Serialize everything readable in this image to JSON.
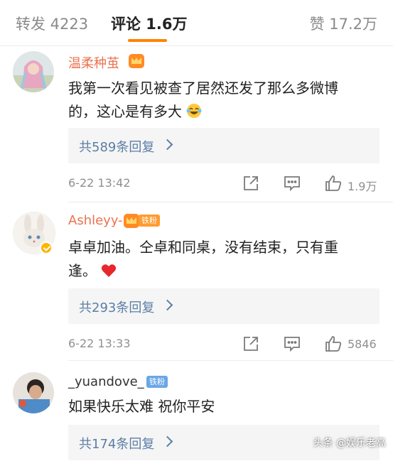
{
  "tabs": {
    "repost": "转发 4223",
    "comments": "评论 1.6万",
    "likes": "赞 17.2万",
    "accent": "#ff8200"
  },
  "comments": [
    {
      "username": "温柔种茧",
      "text_lines": [
        "我第一次看见被查了居然还发了那么多微博",
        "的，这心是有多大"
      ],
      "replies_label": "共589条回复",
      "time": "6-22 13:42",
      "likes": "1.9万",
      "icons": [
        "crown-badge",
        "laughing-emoji",
        "share-icon",
        "reply-icon",
        "thumbs-up-icon"
      ]
    },
    {
      "username": "Ashleyy-",
      "fan_badge": "铁粉",
      "text_lines": [
        "卓卓加油。仝卓和同桌，没有结束，只有重",
        "逢。"
      ],
      "replies_label": "共293条回复",
      "time": "6-22 13:33",
      "likes": "5846",
      "icons": [
        "crown-badge",
        "heart-emoji",
        "verified-badge"
      ]
    },
    {
      "username": "_yuandove_",
      "fan_badge": "铁粉",
      "text": "如果快乐太难 祝你平安",
      "replies_label": "共174条回复"
    }
  ],
  "colors": {
    "username": "#eb7350",
    "reply_link": "#5b7ea6",
    "meta": "#8f8f8f"
  },
  "watermark": "头条 @娱乐老高"
}
